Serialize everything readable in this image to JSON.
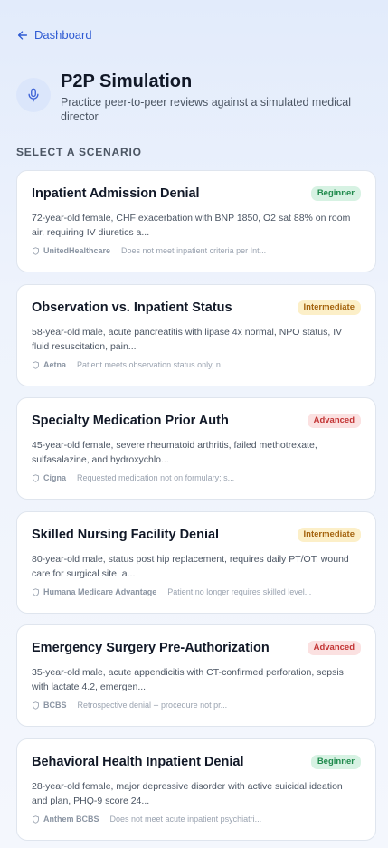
{
  "nav": {
    "back_label": "Dashboard"
  },
  "header": {
    "title": "P2P Simulation",
    "subtitle": "Practice peer-to-peer reviews against a simulated medical director"
  },
  "section": {
    "label": "SELECT A SCENARIO"
  },
  "scenarios": [
    {
      "title": "Inpatient Admission Denial",
      "difficulty": "Beginner",
      "description": "72-year-old female, CHF exacerbation with BNP 1850, O2 sat 88% on room air, requiring IV diuretics a...",
      "payer": "UnitedHealthcare",
      "denial_reason": "Does not meet inpatient criteria per Int..."
    },
    {
      "title": "Observation vs. Inpatient Status",
      "difficulty": "Intermediate",
      "description": "58-year-old male, acute pancreatitis with lipase 4x normal, NPO status, IV fluid resuscitation, pain...",
      "payer": "Aetna",
      "denial_reason": "Patient meets observation status only, n..."
    },
    {
      "title": "Specialty Medication Prior Auth",
      "difficulty": "Advanced",
      "description": "45-year-old female, severe rheumatoid arthritis, failed methotrexate, sulfasalazine, and hydroxychlo...",
      "payer": "Cigna",
      "denial_reason": "Requested medication not on formulary; s..."
    },
    {
      "title": "Skilled Nursing Facility Denial",
      "difficulty": "Intermediate",
      "description": "80-year-old male, status post hip replacement, requires daily PT/OT, wound care for surgical site, a...",
      "payer": "Humana Medicare Advantage",
      "denial_reason": "Patient no longer requires skilled level..."
    },
    {
      "title": "Emergency Surgery Pre-Authorization",
      "difficulty": "Advanced",
      "description": "35-year-old male, acute appendicitis with CT-confirmed perforation, sepsis with lactate 4.2, emergen...",
      "payer": "BCBS",
      "denial_reason": "Retrospective denial -- procedure not pr..."
    },
    {
      "title": "Behavioral Health Inpatient Denial",
      "difficulty": "Beginner",
      "description": "28-year-old female, major depressive disorder with active suicidal ideation and plan, PHQ-9 score 24...",
      "payer": "Anthem BCBS",
      "denial_reason": "Does not meet acute inpatient psychiatri..."
    }
  ],
  "colors": {
    "accent": "#2f5bd3",
    "beginner": "#1f8a4c",
    "intermediate": "#a4630e",
    "advanced": "#c23434"
  }
}
